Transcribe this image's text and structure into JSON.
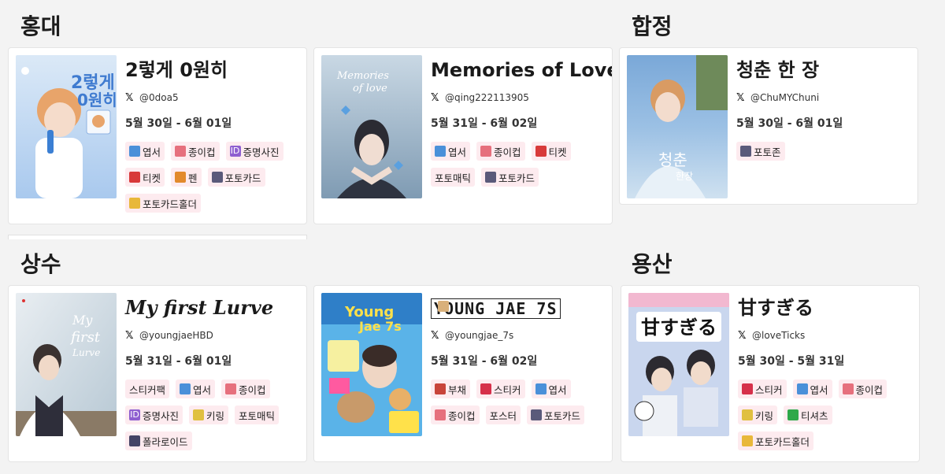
{
  "sections": {
    "hongdae": "홍대",
    "hapjeong": "합정",
    "sangsu": "상수",
    "yongsan": "용산"
  },
  "events": [
    {
      "title": "2렇게 0원히",
      "handle": "@0doa5",
      "dates": "5월 30일 - 6월 01일",
      "tags": [
        {
          "icon": "postcard-icon",
          "label": "엽서"
        },
        {
          "icon": "cup-icon",
          "label": "종이컵"
        },
        {
          "icon": "id-icon",
          "label": "증명사진"
        },
        {
          "icon": "ticket-icon",
          "label": "티켓"
        },
        {
          "icon": "pen-icon",
          "label": "펜"
        },
        {
          "icon": "photo-icon",
          "label": "포토카드"
        },
        {
          "icon": "folder-icon",
          "label": "포토카드홀더"
        }
      ]
    },
    {
      "title": "Memories of Love",
      "handle": "@qing222113905",
      "dates": "5월 31일 - 6월 02일",
      "tags": [
        {
          "icon": "postcard-icon",
          "label": "엽서"
        },
        {
          "icon": "cup-icon",
          "label": "종이컵"
        },
        {
          "icon": "ticket-icon",
          "label": "티켓"
        },
        {
          "icon": "",
          "label": "포토매틱"
        },
        {
          "icon": "photo-icon",
          "label": "포토카드"
        }
      ]
    },
    {
      "title": "청춘 한 장",
      "handle": "@ChuMYChuni",
      "dates": "5월 30일 - 6월 01일",
      "tags": [
        {
          "icon": "photo-icon",
          "label": "포토존"
        }
      ]
    },
    {
      "title": "My first Lurve",
      "handle": "@youngjaeHBD",
      "dates": "5월 31일 - 6월 01일",
      "tags": [
        {
          "icon": "",
          "label": "스티커팩"
        },
        {
          "icon": "postcard-icon",
          "label": "엽서"
        },
        {
          "icon": "cup-icon",
          "label": "종이컵"
        },
        {
          "icon": "id-icon",
          "label": "증명사진"
        },
        {
          "icon": "keyring-icon",
          "label": "키링"
        },
        {
          "icon": "",
          "label": "포토매틱"
        },
        {
          "icon": "polaroid-icon",
          "label": "폴라로이드"
        }
      ]
    },
    {
      "title": "YOUNG JAE 7S",
      "handle": "@youngjae_7s",
      "dates": "5월 31일 - 6월 02일",
      "tags": [
        {
          "icon": "fan-icon",
          "label": "부채"
        },
        {
          "icon": "sticker-icon",
          "label": "스티커"
        },
        {
          "icon": "postcard-icon",
          "label": "엽서"
        },
        {
          "icon": "cup-icon",
          "label": "종이컵"
        },
        {
          "icon": "poster-icon",
          "label": "포스터"
        },
        {
          "icon": "photo-icon",
          "label": "포토카드"
        }
      ]
    },
    {
      "title": "甘すぎる",
      "handle": "@loveTicks",
      "dates": "5월 30일 - 5월 31일",
      "tags": [
        {
          "icon": "sticker-icon",
          "label": "스티커"
        },
        {
          "icon": "postcard-icon",
          "label": "엽서"
        },
        {
          "icon": "cup-icon",
          "label": "종이컵"
        },
        {
          "icon": "keyring-icon",
          "label": "키링"
        },
        {
          "icon": "tshirt-icon",
          "label": "티셔츠"
        },
        {
          "icon": "folder-icon",
          "label": "포토카드홀더"
        }
      ]
    }
  ]
}
